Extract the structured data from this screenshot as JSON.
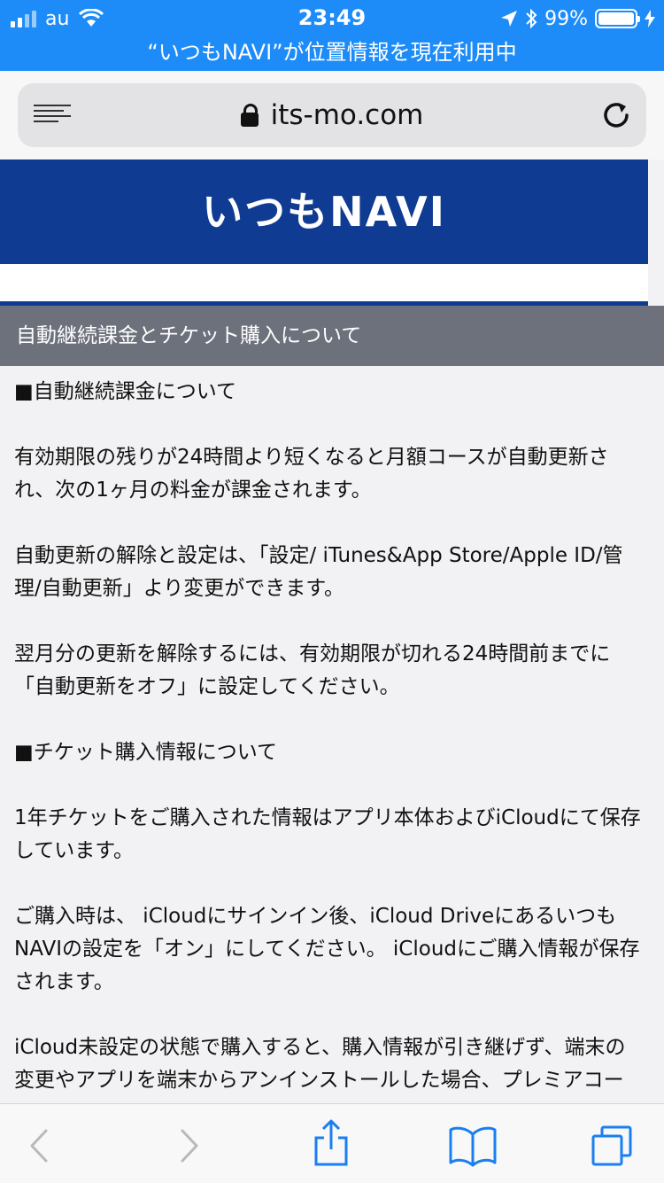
{
  "status_bar": {
    "carrier": "au",
    "time": "23:49",
    "battery": "99%",
    "battery_level": 0.99,
    "location_banner": "“いつもNAVI”が位置情報を現在利用中",
    "icons": [
      "signal-icon",
      "wifi-icon",
      "location-arrow-icon",
      "bluetooth-icon",
      "battery-icon",
      "charging-icon"
    ]
  },
  "browser": {
    "url": "its-mo.com",
    "icons": [
      "reader-icon",
      "lock-icon",
      "reload-icon"
    ]
  },
  "page": {
    "logo": "いつもNAVI",
    "section_title": "自動継続課金とチケット購入について",
    "paragraphs": [
      "■自動継続課金について",
      "有効期限の残りが24時間より短くなると月額コースが自動更新され、次の1ヶ月の料金が課金されます。",
      "自動更新の解除と設定は、「設定/ iTunes&App Store/Apple ID/管理/自動更新」より変更ができます。",
      "翌月分の更新を解除するには、有効期限が切れる24時間前までに「自動更新をオフ」に設定してください。",
      "■チケット購入情報について",
      "1年チケットをご購入された情報はアプリ本体およびiCloudにて保存しています。",
      "ご購入時は、 iCloudにサインイン後、iCloud DriveにあるいつもNAVIの設定を「オン」にしてください。 iCloudにご購入情報が保存されます。",
      "iCloud未設定の状態で購入すると、購入情報が引き継げず、端末の変更やアプリを端末からアンインストールした場合、プレミアコー"
    ]
  },
  "toolbar": {
    "icons": [
      "back-icon",
      "forward-icon",
      "share-icon",
      "bookmarks-icon",
      "tabs-icon"
    ]
  },
  "colors": {
    "status_bar": "#1d8cf8",
    "banner": "#0f3b93",
    "section_header": "#6c717b",
    "toolbar_icon": "#1a7ff0",
    "toolbar_icon_disabled": "#b8b8bd"
  }
}
